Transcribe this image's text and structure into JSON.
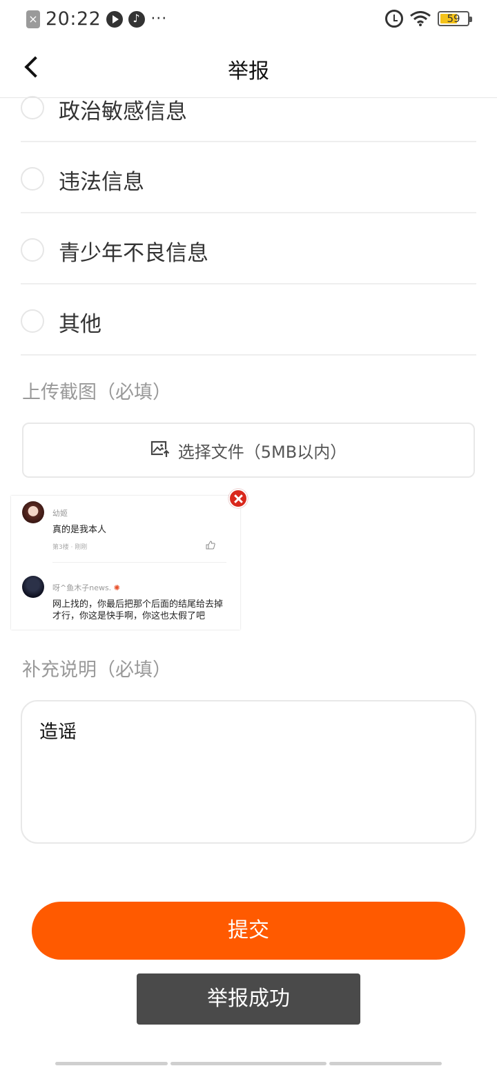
{
  "status_bar": {
    "time": "20:22",
    "battery": "59",
    "left_icons": [
      "notification-x-icon",
      "video-play-icon",
      "music-icon",
      "more-dots-icon"
    ],
    "right_icons": [
      "alarm-icon",
      "wifi-icon",
      "battery-icon"
    ],
    "more": "···"
  },
  "header": {
    "title": "举报"
  },
  "options": [
    {
      "label": "政治敏感信息",
      "selected": false
    },
    {
      "label": "违法信息",
      "selected": false
    },
    {
      "label": "青少年不良信息",
      "selected": false
    },
    {
      "label": "其他",
      "selected": false
    }
  ],
  "upload": {
    "section_label": "上传截图（必填）",
    "button_label": "选择文件（5MB以内）"
  },
  "screenshot": {
    "comments": [
      {
        "name": "幼姬",
        "text": "真的是我本人",
        "meta": "第3楼 · 刚刚"
      },
      {
        "name": "呀^鱼木子news.",
        "text": "网上找的，你最后把那个后面的结尾给去掉才行，你这是快手啊，你这也太假了吧"
      }
    ]
  },
  "description": {
    "section_label": "补充说明（必填）",
    "value": "造谣"
  },
  "submit_label": "提交",
  "toast_text": "举报成功",
  "colors": {
    "accent": "#ff5a00",
    "toast_bg": "#4a4a4a",
    "remove_red": "#d9281c"
  }
}
